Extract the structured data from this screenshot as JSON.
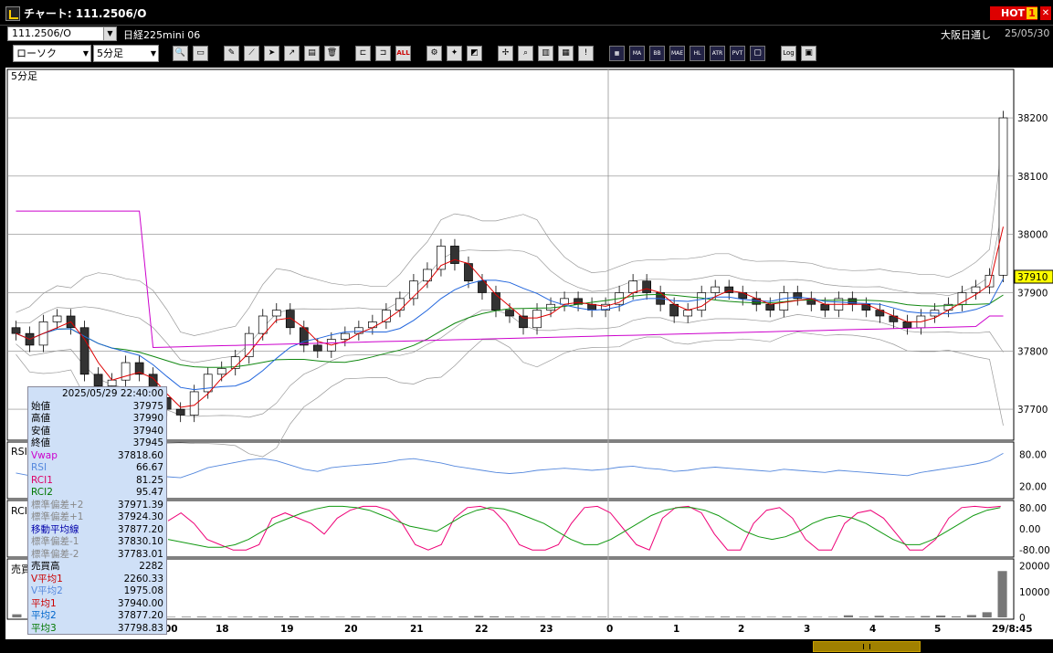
{
  "window": {
    "title": "チャート: 111.2506/O",
    "hot_label": "HOT",
    "hot_number": "1",
    "close": "✕"
  },
  "symbol_bar": {
    "code": "111.2506/O",
    "name": "日経225mini 06",
    "session": "大阪日通し",
    "date": "25/05/30"
  },
  "toolbar": {
    "chart_type": "ローソク",
    "interval": "5分足",
    "indicator_buttons": [
      "MA",
      "BB",
      "MAE",
      "HL",
      "ATR",
      "PVT"
    ],
    "all_label": "ALL",
    "log_label": "Log"
  },
  "panes": {
    "price_label": "5分足",
    "rsi_label": "RSI",
    "rci_label": "RCI",
    "volume_label": "売買"
  },
  "price_axis": {
    "labels": [
      "38200",
      "38100",
      "38000",
      "37900",
      "37800",
      "37700"
    ],
    "current": "37910"
  },
  "rsi_axis": {
    "labels": [
      "80.00",
      "20.00"
    ]
  },
  "rci_axis": {
    "labels": [
      "80.00",
      "0.00",
      "-80.00"
    ]
  },
  "volume_axis": {
    "labels": [
      "20000",
      "10000",
      "0"
    ]
  },
  "time_axis": {
    "labels": [
      "00",
      "18",
      "19",
      "20",
      "21",
      "22",
      "23",
      "0",
      "1",
      "2",
      "3",
      "4",
      "5"
    ],
    "last": "29/8:45"
  },
  "info": {
    "datetime": "2025/05/29 22:40:00",
    "rows": [
      {
        "label": "始値",
        "value": "37975",
        "color": "#000000"
      },
      {
        "label": "高値",
        "value": "37990",
        "color": "#000000"
      },
      {
        "label": "安値",
        "value": "37940",
        "color": "#000000"
      },
      {
        "label": "終値",
        "value": "37945",
        "color": "#000000"
      },
      {
        "label": "Vwap",
        "value": "37818.60",
        "color": "#cc00cc"
      },
      {
        "label": "RSI",
        "value": "66.67",
        "color": "#5588dd"
      },
      {
        "label": "RCI1",
        "value": "81.25",
        "color": "#dd0066"
      },
      {
        "label": "RCI2",
        "value": "95.47",
        "color": "#007700"
      },
      {
        "label": "標準偏差+2",
        "value": "37971.39",
        "color": "#888888"
      },
      {
        "label": "標準偏差+1",
        "value": "37924.30",
        "color": "#888888"
      },
      {
        "label": "移動平均線",
        "value": "37877.20",
        "color": "#0000aa"
      },
      {
        "label": "標準偏差-1",
        "value": "37830.10",
        "color": "#888888"
      },
      {
        "label": "標準偏差-2",
        "value": "37783.01",
        "color": "#888888"
      },
      {
        "label": "売買高",
        "value": "2282",
        "color": "#000000"
      },
      {
        "label": "V平均1",
        "value": "2260.33",
        "color": "#cc0000"
      },
      {
        "label": "V平均2",
        "value": "1975.08",
        "color": "#5588dd"
      },
      {
        "label": "平均1",
        "value": "37940.00",
        "color": "#cc0000"
      },
      {
        "label": "平均2",
        "value": "37877.20",
        "color": "#0066cc"
      },
      {
        "label": "平均3",
        "value": "37798.83",
        "color": "#007700"
      }
    ]
  },
  "colors": {
    "up_candle": "#ffffff",
    "down_candle": "#333333",
    "ma_short": "#dd0000",
    "ma_mid": "#2266dd",
    "ma_long": "#118811",
    "vwap": "#cc00cc",
    "bands": "#999999",
    "rsi": "#5588dd",
    "rci1": "#ee0077",
    "rci2": "#119911"
  },
  "chart_data": {
    "type": "line",
    "series": [
      {
        "name": "終値",
        "values": [
          37830,
          37810,
          37850,
          37860,
          37840,
          37760,
          37740,
          37750,
          37780,
          37760,
          37720,
          37700,
          37690,
          37730,
          37760,
          37770,
          37790,
          37830,
          37860,
          37870,
          37840,
          37810,
          37800,
          37820,
          37830,
          37840,
          37850,
          37870,
          37890,
          37920,
          37940,
          37980,
          37950,
          37920,
          37900,
          37870,
          37860,
          37840,
          37870,
          37880,
          37890,
          37880,
          37870,
          37880,
          37900,
          37920,
          37900,
          37880,
          37860,
          37870,
          37900,
          37910,
          37900,
          37890,
          37880,
          37870,
          37900,
          37890,
          37880,
          37870,
          37890,
          37880,
          37870,
          37860,
          37850,
          37840,
          37860,
          37870,
          37880,
          37900,
          37910,
          37930,
          38200
        ]
      },
      {
        "name": "RSI",
        "values": [
          45,
          40,
          48,
          52,
          50,
          42,
          38,
          44,
          50,
          46,
          40,
          38,
          36,
          45,
          55,
          60,
          65,
          70,
          72,
          68,
          60,
          52,
          48,
          55,
          58,
          60,
          62,
          65,
          70,
          72,
          68,
          64,
          58,
          54,
          50,
          46,
          44,
          46,
          50,
          52,
          54,
          52,
          50,
          52,
          56,
          58,
          54,
          52,
          48,
          50,
          54,
          56,
          54,
          52,
          50,
          48,
          52,
          50,
          48,
          46,
          50,
          48,
          46,
          44,
          42,
          40,
          46,
          50,
          54,
          58,
          62,
          68,
          82
        ]
      },
      {
        "name": "RCI1",
        "values": [
          30,
          60,
          20,
          -40,
          -60,
          -80,
          -80,
          -60,
          40,
          60,
          40,
          20,
          -20,
          40,
          70,
          85,
          85,
          70,
          20,
          -60,
          -80,
          -60,
          40,
          80,
          85,
          70,
          20,
          -60,
          -80,
          -80,
          -60,
          20,
          80,
          85,
          60,
          0,
          -60,
          -80,
          40,
          80,
          85,
          60,
          -20,
          -80,
          -80,
          20,
          70,
          80,
          40,
          -40,
          -80,
          -80,
          20,
          60,
          70,
          40,
          -20,
          -80,
          -80,
          -40,
          40,
          80,
          85,
          80,
          85
        ]
      },
      {
        "name": "RCI2",
        "values": [
          -40,
          -50,
          -60,
          -70,
          -70,
          -60,
          -40,
          -10,
          20,
          40,
          60,
          75,
          85,
          85,
          80,
          70,
          50,
          30,
          10,
          0,
          -10,
          20,
          50,
          70,
          80,
          75,
          60,
          40,
          20,
          -10,
          -40,
          -60,
          -60,
          -40,
          -10,
          20,
          50,
          70,
          80,
          80,
          70,
          50,
          20,
          -10,
          -30,
          -40,
          -30,
          -10,
          20,
          40,
          50,
          40,
          20,
          -10,
          -40,
          -60,
          -60,
          -40,
          -10,
          20,
          50,
          70,
          80
        ]
      },
      {
        "name": "売買高",
        "values": [
          1200,
          600,
          500,
          400,
          300,
          300,
          200,
          300,
          250,
          200,
          200,
          250,
          300,
          200,
          250,
          300,
          300,
          350,
          400,
          300,
          250,
          200,
          300,
          250,
          200,
          200,
          300,
          250,
          300,
          350,
          500,
          400,
          300,
          250,
          200,
          250,
          200,
          200,
          250,
          200,
          200,
          250,
          300,
          200,
          200,
          250,
          300,
          250,
          200,
          200,
          300,
          250,
          200,
          200,
          800,
          300,
          600,
          400,
          300,
          500,
          700,
          400,
          900,
          2000,
          18000
        ]
      }
    ],
    "ylim": [
      37650,
      38280
    ]
  }
}
